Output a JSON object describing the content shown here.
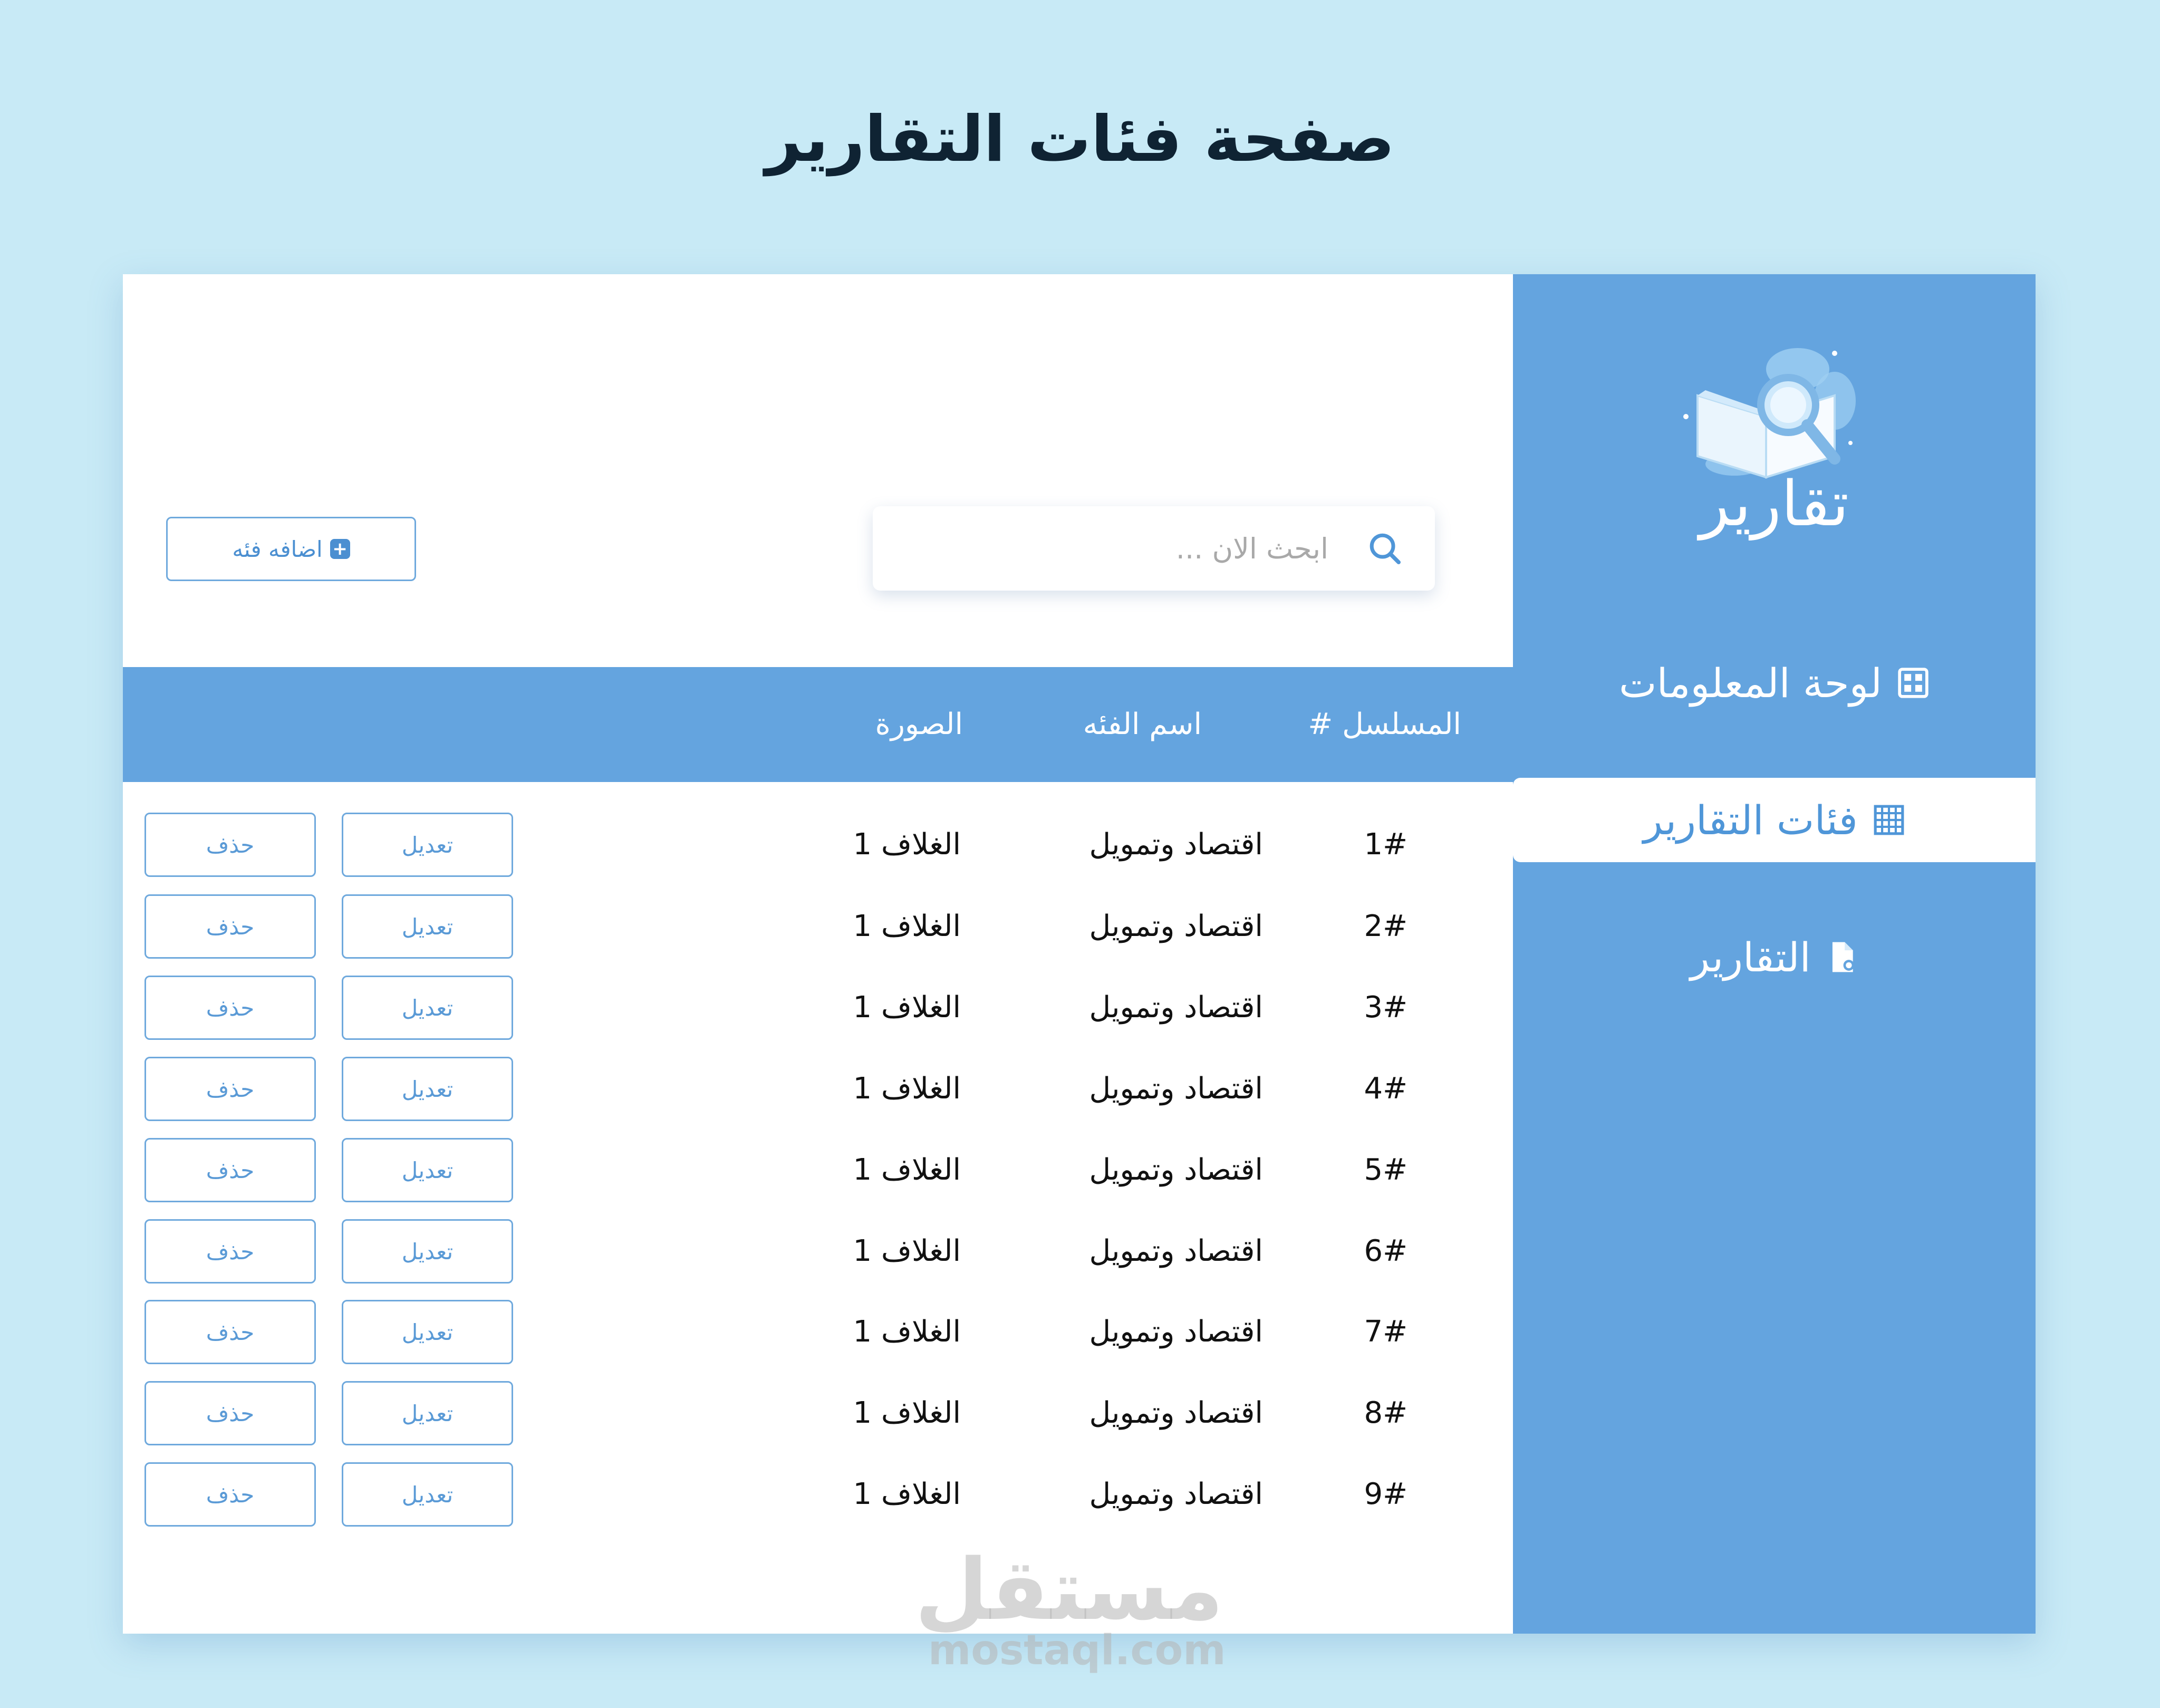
{
  "page_title": "صفحة  فئات التقارير",
  "logo": {
    "text": "تقارير",
    "icon": "book-magnifier-icon"
  },
  "sidebar": {
    "items": [
      {
        "label": "لوحة المعلومات",
        "icon": "dashboard-grid-icon",
        "active": false
      },
      {
        "label": "فئات التقارير",
        "icon": "table-grid-icon",
        "active": true
      },
      {
        "label": "التقارير",
        "icon": "document-icon",
        "active": false
      }
    ]
  },
  "search": {
    "placeholder": "ابحث الان ...",
    "value": ""
  },
  "add_button": {
    "label": "اضافه فئه",
    "icon": "plus-square-icon"
  },
  "table": {
    "headers": {
      "serial": "المسلسل #",
      "name": "اسم الفئه",
      "image": "الصورة"
    },
    "edit_label": "تعديل",
    "delete_label": "حذف",
    "rows": [
      {
        "serial": "1#",
        "name": "اقتصاد وتمويل",
        "image": "الغلاف 1"
      },
      {
        "serial": "2#",
        "name": "اقتصاد وتمويل",
        "image": "الغلاف 1"
      },
      {
        "serial": "3#",
        "name": "اقتصاد وتمويل",
        "image": "الغلاف 1"
      },
      {
        "serial": "4#",
        "name": "اقتصاد وتمويل",
        "image": "الغلاف 1"
      },
      {
        "serial": "5#",
        "name": "اقتصاد وتمويل",
        "image": "الغلاف 1"
      },
      {
        "serial": "6#",
        "name": "اقتصاد وتمويل",
        "image": "الغلاف 1"
      },
      {
        "serial": "7#",
        "name": "اقتصاد وتمويل",
        "image": "الغلاف 1"
      },
      {
        "serial": "8#",
        "name": "اقتصاد وتمويل",
        "image": "الغلاف 1"
      },
      {
        "serial": "9#",
        "name": "اقتصاد وتمويل",
        "image": "الغلاف 1"
      }
    ]
  },
  "watermark": {
    "arabic": "مستقل",
    "latin": "mostaql.com"
  },
  "colors": {
    "background": "#c8eaf6",
    "accent": "#64a4df",
    "button_border": "#6fa9dd",
    "title": "#0f2333"
  }
}
